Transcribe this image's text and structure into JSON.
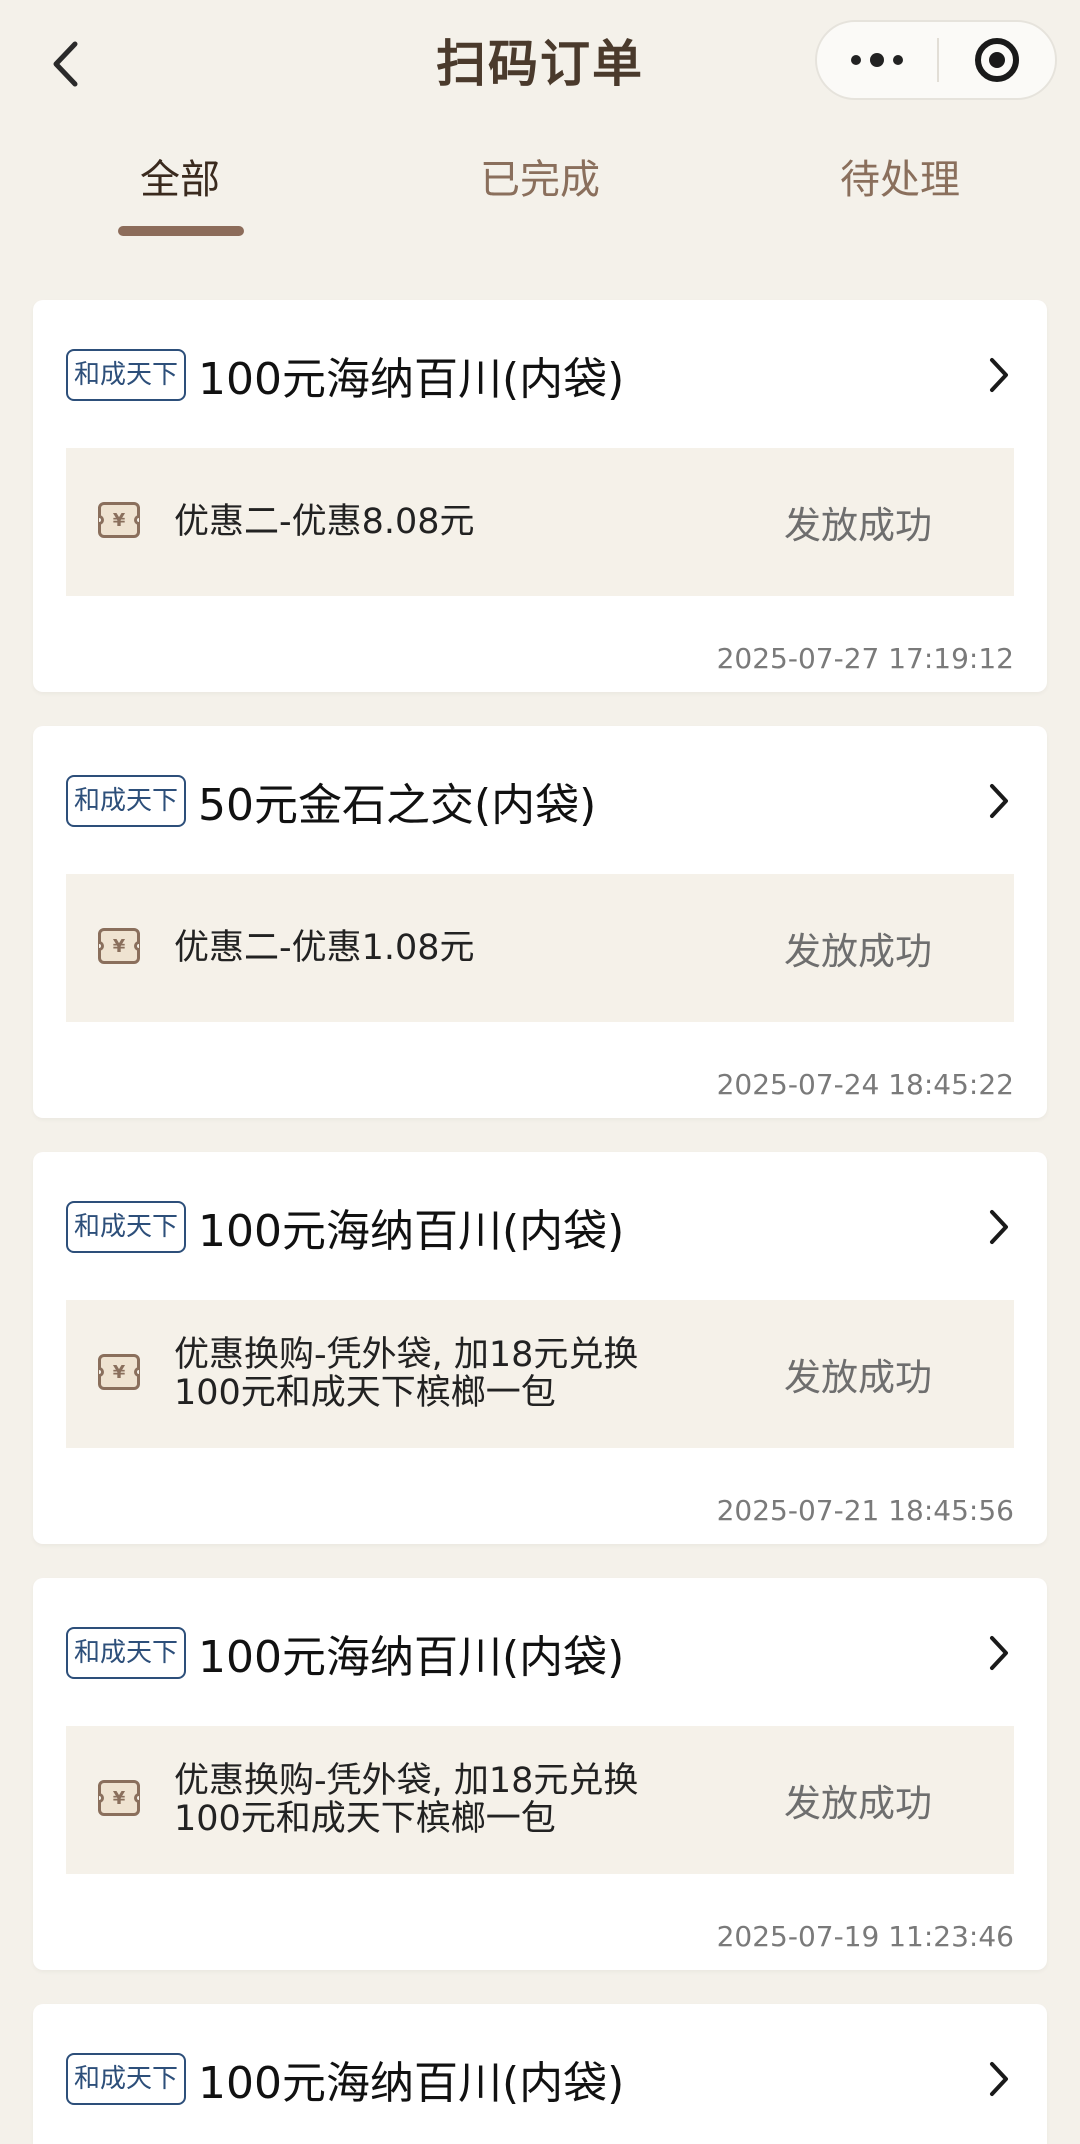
{
  "header": {
    "title": "扫码订单",
    "back_icon": "chevron-left-icon",
    "more_icon": "more-dots-icon",
    "close_icon": "target-close-icon"
  },
  "tabs": [
    {
      "label": "全部",
      "active": true
    },
    {
      "label": "已完成",
      "active": false
    },
    {
      "label": "待处理",
      "active": false
    }
  ],
  "orders": [
    {
      "brand": "和成天下",
      "product": "100元海纳百川(内袋)",
      "coupon": "优惠二-优惠8.08元",
      "status": "发放成功",
      "time": "2025-07-27 17:19:12"
    },
    {
      "brand": "和成天下",
      "product": "50元金石之交(内袋)",
      "coupon": "优惠二-优惠1.08元",
      "status": "发放成功",
      "time": "2025-07-24 18:45:22"
    },
    {
      "brand": "和成天下",
      "product": "100元海纳百川(内袋)",
      "coupon": "优惠换购-凭外袋, 加18元兑换100元和成天下槟榔一包",
      "status": "发放成功",
      "time": "2025-07-21 18:45:56"
    },
    {
      "brand": "和成天下",
      "product": "100元海纳百川(内袋)",
      "coupon": "优惠换购-凭外袋, 加18元兑换100元和成天下槟榔一包",
      "status": "发放成功",
      "time": "2025-07-19 11:23:46"
    },
    {
      "brand": "和成天下",
      "product": "100元海纳百川(内袋)"
    }
  ],
  "colors": {
    "background": "#f4f1ea",
    "accent": "#8c6c5a",
    "brand_tag": "#2d4f7a"
  }
}
